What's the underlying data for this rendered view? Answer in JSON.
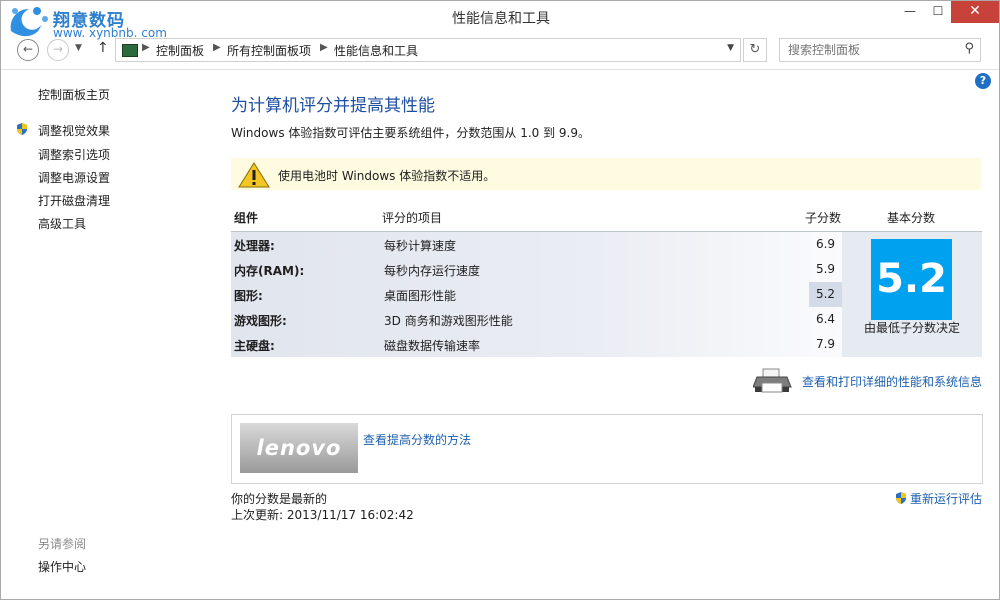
{
  "watermark": {
    "brand": "翔意数码",
    "url": "www. xynbnb. com"
  },
  "window": {
    "title": "性能信息和工具",
    "min": "—",
    "max": "☐",
    "close": "✕"
  },
  "nav": {
    "back": "←",
    "forward": "→",
    "recent": "▼",
    "up": "↑",
    "breadcrumbs": [
      "控制面板",
      "所有控制面板项",
      "性能信息和工具"
    ],
    "refresh": "↻",
    "search_placeholder": "搜索控制面板"
  },
  "sidebar": {
    "home": "控制面板主页",
    "links": [
      "调整视觉效果",
      "调整索引选项",
      "调整电源设置",
      "打开磁盘清理",
      "高级工具"
    ],
    "see_also": "另请参阅",
    "see_also_links": [
      "操作中心"
    ]
  },
  "main": {
    "help": "?",
    "heading": "为计算机评分并提高其性能",
    "description": "Windows 体验指数可评估主要系统组件，分数范围从 1.0 到 9.9。",
    "warning": "使用电池时 Windows 体验指数不适用。",
    "table": {
      "headers": [
        "组件",
        "评分的项目",
        "子分数",
        "基本分数"
      ],
      "rows": [
        {
          "component": "处理器:",
          "item": "每秒计算速度",
          "score": "6.9"
        },
        {
          "component": "内存(RAM):",
          "item": "每秒内存运行速度",
          "score": "5.9"
        },
        {
          "component": "图形:",
          "item": "桌面图形性能",
          "score": "5.2"
        },
        {
          "component": "游戏图形:",
          "item": "3D 商务和游戏图形性能",
          "score": "6.4"
        },
        {
          "component": "主硬盘:",
          "item": "磁盘数据传输速率",
          "score": "7.9"
        }
      ],
      "base_score": "5.2",
      "base_note": "由最低子分数决定"
    },
    "print_link": "查看和打印详细的性能和系统信息",
    "brand_logo": "lenovo",
    "tips_link": "查看提高分数的方法",
    "status_current": "你的分数是最新的",
    "last_update": "上次更新: 2013/11/17 16:02:42",
    "rerun": "重新运行评估"
  },
  "colors": {
    "accent": "#00a2ef",
    "link": "#1c5fae",
    "heading": "#1e4fa0",
    "close": "#c7433a"
  }
}
